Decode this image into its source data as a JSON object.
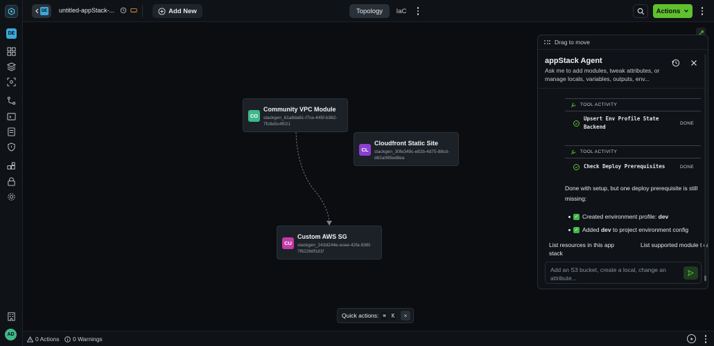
{
  "rail": {
    "workspace_badge": "DE",
    "user_initials": "AD"
  },
  "topbar": {
    "workspace_badge": "DE",
    "stack_title": "untitled-appStack-...",
    "add_new_label": "Add New",
    "tabs": [
      {
        "label": "Topology",
        "active": true
      },
      {
        "label": "IaC",
        "active": false
      }
    ],
    "actions_label": "Actions"
  },
  "nodes": [
    {
      "badge": "CO",
      "badge_color": "#3fb88a",
      "title": "Community VPC Module",
      "id_text": "stackgen_61a8da61-f7ce-445f-b362-7fc8e5c4f021"
    },
    {
      "badge": "CL",
      "badge_color": "#8a3fd1",
      "title": "Cloudfront Static Site",
      "id_text": "stackgen_30fe349c-e82b-4d75-88cd-d82a085ed8ea"
    },
    {
      "badge": "CU",
      "badge_color": "#c23aa8",
      "title": "Custom AWS SG",
      "id_text": "stackgen_243d244e-ecee-42fa-936f-7f6228df1d1f"
    }
  ],
  "quick_actions": {
    "label": "Quick actions:",
    "shortcut_1": "⌘",
    "shortcut_2": "K"
  },
  "agent": {
    "drag_label": "Drag to move",
    "title": "appStack Agent",
    "subtitle": "Ask me to add modules, tweak attributes, or manage locals, variables, outputs, env...",
    "tool_activity_label": "TOOL ACTIVITY",
    "tools": [
      {
        "name": "Upsert Env Profile State Backend",
        "status": "DONE"
      },
      {
        "name": "Check Deploy Prerequisites",
        "status": "DONE"
      }
    ],
    "message": "Done with setup, but one deploy prerequisite is still missing:",
    "bullets": [
      {
        "prefix": "Created environment profile: ",
        "bold": "dev",
        "suffix": ""
      },
      {
        "prefix": "Added ",
        "bold": "dev",
        "suffix": " to project environment config"
      }
    ],
    "suggestions": [
      "List resources in this app stack",
      "List supported module t can add"
    ],
    "input_placeholder": "Add an S3 bucket, create a local, change an attribute..."
  },
  "statusbar": {
    "actions_count": "0 Actions",
    "warnings_count": "0 Warnings"
  },
  "colors": {
    "accent_green": "#5fc12e",
    "panel_bg": "#0f1216",
    "canvas_bg": "#0b0d10"
  }
}
